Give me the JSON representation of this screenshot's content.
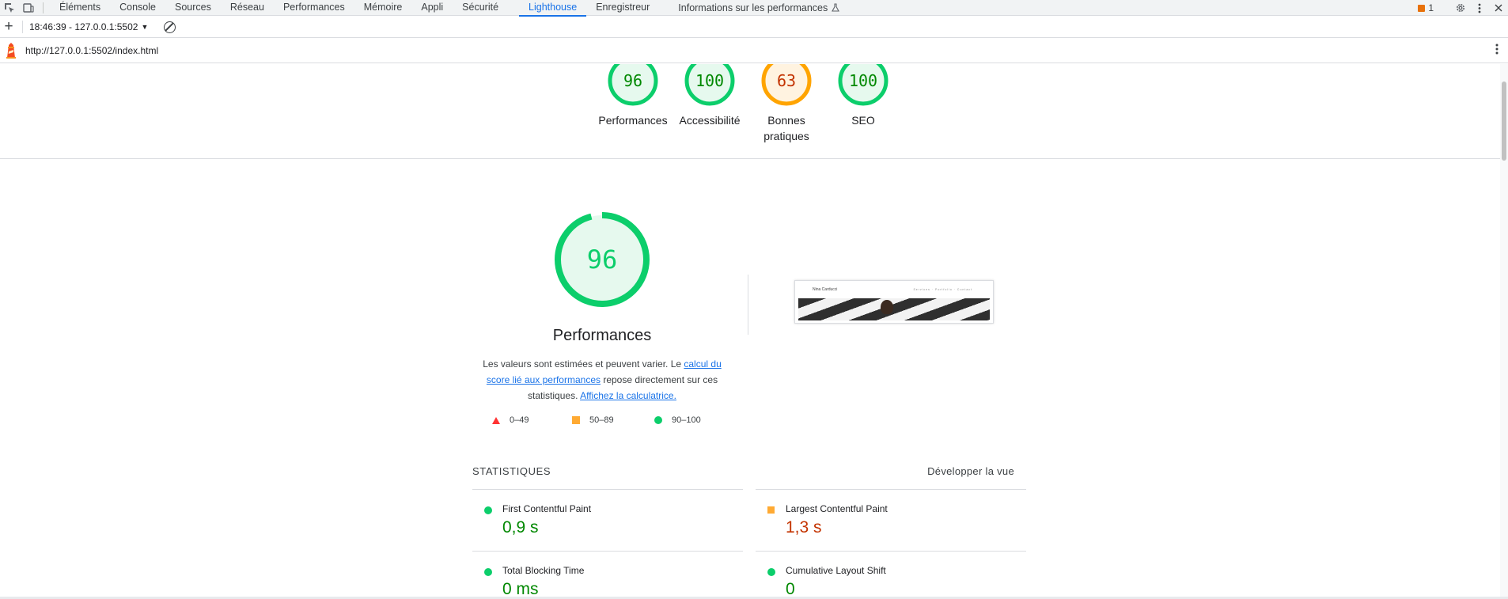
{
  "devtools": {
    "tabs": [
      "Éléments",
      "Console",
      "Sources",
      "Réseau",
      "Performances",
      "Mémoire",
      "Appli",
      "Sécurité",
      "Lighthouse",
      "Enregistreur",
      "Informations sur les performances"
    ],
    "active_tab": "Lighthouse",
    "issues_count": "1",
    "icons": {
      "inspect": "inspect-element-icon",
      "device": "device-toolbar-icon",
      "flask": "experiment-icon",
      "issues": "issue-flag-icon",
      "settings": "gear-icon",
      "more": "kebab-menu-icon",
      "close": "close-icon"
    }
  },
  "lighthouse_toolbar": {
    "report_label": "18:46:39 - 127.0.0.1:5502",
    "url": "http://127.0.0.1:5502/index.html"
  },
  "gauges": [
    {
      "score": "96",
      "label": "Performances",
      "rating": "pass"
    },
    {
      "score": "100",
      "label": "Accessibilité",
      "rating": "pass"
    },
    {
      "score": "63",
      "label": "Bonnes pratiques",
      "rating": "average"
    },
    {
      "score": "100",
      "label": "SEO",
      "rating": "pass"
    }
  ],
  "performance": {
    "score": "96",
    "score_fraction": 0.96,
    "title": "Performances",
    "desc_1": "Les valeurs sont estimées et peuvent varier. Le ",
    "desc_link_1": "calcul du score lié aux performances",
    "desc_2": " repose directement sur ces statistiques. ",
    "desc_link_2": "Affichez la calculatrice.",
    "legend": [
      "0–49",
      "50–89",
      "90–100"
    ]
  },
  "screenshot": {
    "site_title": "Nina Carducci",
    "nav_items": "Services · Portfolio · Contact"
  },
  "statistics": {
    "heading": "STATISTIQUES",
    "expand_label": "Développer la vue",
    "metrics": [
      {
        "name": "First Contentful Paint",
        "value": "0,9 s",
        "rating": "pass"
      },
      {
        "name": "Largest Contentful Paint",
        "value": "1,3 s",
        "rating": "average"
      },
      {
        "name": "Total Blocking Time",
        "value": "0 ms",
        "rating": "pass"
      },
      {
        "name": "Cumulative Layout Shift",
        "value": "0",
        "rating": "pass"
      }
    ]
  },
  "colors": {
    "pass": "#0cce6b",
    "pass_text": "#008800",
    "average": "#ffa400",
    "average_text": "#c33300",
    "fail": "#ff3333",
    "accent": "#1a73e8"
  }
}
